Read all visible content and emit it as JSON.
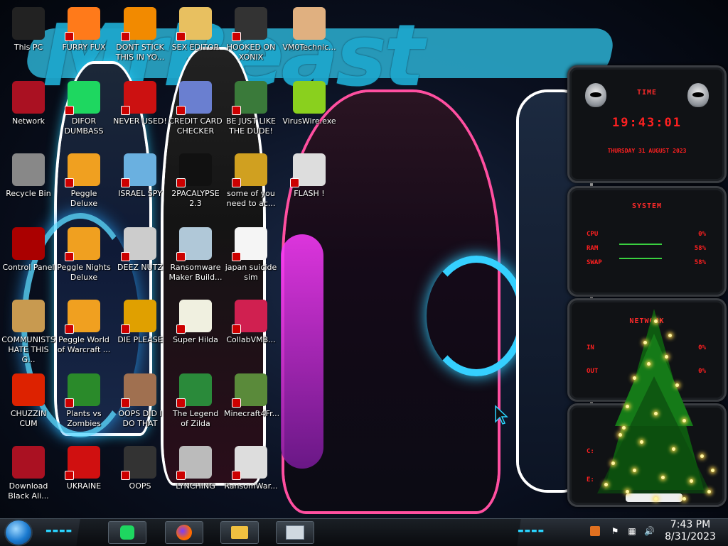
{
  "wallpaper": {
    "title": "MrBeast"
  },
  "desktop_icons": [
    {
      "id": "this-pc",
      "label": "This PC",
      "icon": "computer-icon",
      "color": "#222222"
    },
    {
      "id": "furry-fux",
      "label": "FURRY FUX",
      "icon": "firefox-icon",
      "color": "#ff7a1a"
    },
    {
      "id": "dont-stick",
      "label": "DONT STICK THIS IN YO...",
      "icon": "vlc-cone-icon",
      "color": "#f28a00"
    },
    {
      "id": "sex-editor",
      "label": "SEX EDITOR",
      "icon": "hxd-icon",
      "color": "#e8c060"
    },
    {
      "id": "hooked-on-xonix",
      "label": "HOOKED ON XONIX",
      "icon": "xonix-icon",
      "color": "#333333"
    },
    {
      "id": "vm0",
      "label": "VM0Technic...",
      "icon": "doctor-icon",
      "color": "#e0b080"
    },
    {
      "id": "network",
      "label": "Network",
      "icon": "network-icon",
      "color": "#aa1122"
    },
    {
      "id": "difor",
      "label": "DIFOR DUMBASS",
      "icon": "spotify-icon",
      "color": "#1ed760"
    },
    {
      "id": "never-used",
      "label": "NEVER USED!",
      "icon": "devcpp-icon",
      "color": "#cc1111"
    },
    {
      "id": "credit-card",
      "label": "CREDIT CARD CHECKER",
      "icon": "credit-card-icon",
      "color": "#6a7fd0"
    },
    {
      "id": "be-just-like",
      "label": "BE JUST LIKE THE DUDE!",
      "icon": "santa-icon",
      "color": "#3a7a3a"
    },
    {
      "id": "viruswire",
      "label": "VirusWire.exe",
      "icon": "lime-icon",
      "color": "#8ad01e"
    },
    {
      "id": "recycle-bin",
      "label": "Recycle Bin",
      "icon": "recycle-bin-icon",
      "color": "#888888"
    },
    {
      "id": "peggle-deluxe",
      "label": "Peggle Deluxe",
      "icon": "peggle-icon",
      "color": "#f0a020"
    },
    {
      "id": "israel-spy",
      "label": "ISRAEL SPY",
      "icon": "spy-icon",
      "color": "#6ab0e0"
    },
    {
      "id": "2pacalypse",
      "label": "2PACALYPSE 2.3",
      "icon": "terminal-icon",
      "color": "#111111"
    },
    {
      "id": "some-of-you",
      "label": "some of you need to ac...",
      "icon": "bear-icon",
      "color": "#d0a020"
    },
    {
      "id": "flash",
      "label": "FLASH !",
      "icon": "flash-icon",
      "color": "#dddddd"
    },
    {
      "id": "control-panel",
      "label": "Control Panel",
      "icon": "control-panel-icon",
      "color": "#aa0000"
    },
    {
      "id": "peggle-nights",
      "label": "Peggle Nights Deluxe",
      "icon": "peggle-icon",
      "color": "#f0a020"
    },
    {
      "id": "deez-nutz",
      "label": "DEEZ NUTZ",
      "icon": "windows-stack-icon",
      "color": "#cccccc"
    },
    {
      "id": "ransomware-maker",
      "label": "Ransomware Maker Build...",
      "icon": "window-app-icon",
      "color": "#b0c8d8"
    },
    {
      "id": "japan-suicide",
      "label": "japan suicide sim",
      "icon": "file-icon",
      "color": "#f5f5f5"
    },
    {
      "id": "communists",
      "label": "COMMUNISTS HATE THIS G...",
      "icon": "money-bag-icon",
      "color": "#c89a50"
    },
    {
      "id": "peggle-wow",
      "label": "Peggle World of Warcraft ...",
      "icon": "peggle-icon",
      "color": "#f0a020"
    },
    {
      "id": "die-please",
      "label": "DIE PLEASE",
      "icon": "de-icon",
      "color": "#e0a000"
    },
    {
      "id": "super-hilda",
      "label": "Super Hilda",
      "icon": "pixel-icon",
      "color": "#f0f0e0"
    },
    {
      "id": "collabvmb",
      "label": "CollabVMB...",
      "icon": "monitor-icon",
      "color": "#d02050"
    },
    {
      "id": "chuzzin",
      "label": "CHUZZIN CUM",
      "icon": "chuzzle-icon",
      "color": "#dd2200"
    },
    {
      "id": "plants-vs-zombies",
      "label": "Plants vs Zombies",
      "icon": "flower-icon",
      "color": "#2a8a2a"
    },
    {
      "id": "oops-did",
      "label": "OOPS DID I DO THAT",
      "icon": "portrait-icon",
      "color": "#a07050"
    },
    {
      "id": "legend-of-zilda",
      "label": "The Legend of Zilda",
      "icon": "link-icon",
      "color": "#2a8a3a"
    },
    {
      "id": "minecraft",
      "label": "Minecraft4Fr...",
      "icon": "grass-block-icon",
      "color": "#5a8a3a"
    },
    {
      "id": "download-black",
      "label": "Download Black Ali...",
      "icon": "network-icon",
      "color": "#aa1122"
    },
    {
      "id": "ukraine",
      "label": "UKRAINE",
      "icon": "radiation-icon",
      "color": "#d01010"
    },
    {
      "id": "oops",
      "label": "OOPS",
      "icon": "book-icon",
      "color": "#333333"
    },
    {
      "id": "lynching",
      "label": "LYNCHING",
      "icon": "gears-icon",
      "color": "#bbbbbb"
    },
    {
      "id": "ransomwar",
      "label": "RansomWar...",
      "icon": "skull-icon",
      "color": "#dddddd"
    }
  ],
  "widgets": {
    "time": {
      "header": "TIME",
      "time": "19:43:01",
      "date": "THURSDAY 31 AUGUST 2023"
    },
    "system": {
      "header": "SYSTEM",
      "rows": [
        {
          "label": "CPU",
          "value": "0%"
        },
        {
          "label": "RAM",
          "value": "58%"
        },
        {
          "label": "SWAP",
          "value": "58%"
        }
      ]
    },
    "network": {
      "header": "NETWORK",
      "rows": [
        {
          "label": "IN",
          "value": "0%"
        },
        {
          "label": "OUT",
          "value": "0%"
        }
      ]
    },
    "drives": {
      "rows": [
        {
          "label": "C:",
          "value": ""
        },
        {
          "label": "E:",
          "value": ""
        }
      ]
    }
  },
  "taskbar": {
    "pinned": [
      {
        "name": "spotify",
        "icon": "spotify-icon"
      },
      {
        "name": "firefox",
        "icon": "firefox-icon"
      },
      {
        "name": "file-explorer",
        "icon": "folder-icon"
      },
      {
        "name": "control-panel",
        "icon": "monitor-chart-icon"
      }
    ],
    "clock": {
      "time": "7:43 PM",
      "date": "8/31/2023"
    }
  },
  "colors": {
    "widget_text": "#ff2020",
    "accent": "#1ea6cc",
    "taskbar": "#1c2127"
  }
}
